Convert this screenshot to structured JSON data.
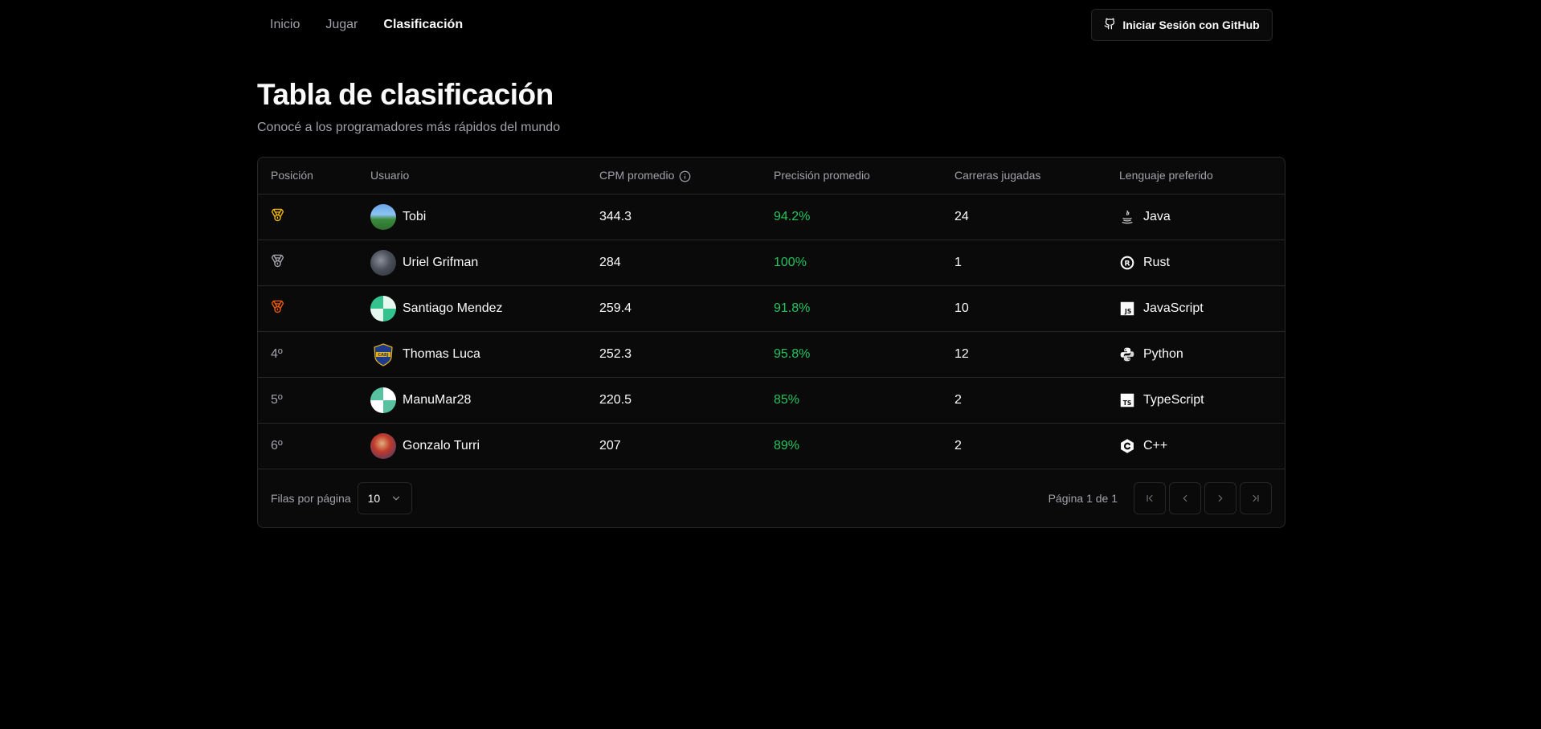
{
  "nav": {
    "links": [
      "Inicio",
      "Jugar",
      "Clasificación"
    ],
    "active": "Clasificación",
    "login_label": "Iniciar Sesión con GitHub"
  },
  "page": {
    "title": "Tabla de clasificación",
    "subtitle": "Conocé a los programadores más rápidos del mundo"
  },
  "table": {
    "headers": [
      "Posición",
      "Usuario",
      "CPM promedio",
      "Precisión promedio",
      "Carreras jugadas",
      "Lenguaje preferido"
    ],
    "rows": [
      {
        "position": "",
        "medal": "gold",
        "user": "Tobi",
        "cpm": "344.3",
        "precision": "94.2%",
        "races": "24",
        "language": "Java",
        "lang_icon": "java-icon"
      },
      {
        "position": "",
        "medal": "silver",
        "user": "Uriel Grifman",
        "cpm": "284",
        "precision": "100%",
        "races": "1",
        "language": "Rust",
        "lang_icon": "rust-icon"
      },
      {
        "position": "",
        "medal": "bronze",
        "user": "Santiago Mendez",
        "cpm": "259.4",
        "precision": "91.8%",
        "races": "10",
        "language": "JavaScript",
        "lang_icon": "javascript-icon"
      },
      {
        "position": "4º",
        "medal": "",
        "user": "Thomas Luca",
        "cpm": "252.3",
        "precision": "95.8%",
        "races": "12",
        "language": "Python",
        "lang_icon": "python-icon"
      },
      {
        "position": "5º",
        "medal": "",
        "user": "ManuMar28",
        "cpm": "220.5",
        "precision": "85%",
        "races": "2",
        "language": "TypeScript",
        "lang_icon": "typescript-icon"
      },
      {
        "position": "6º",
        "medal": "",
        "user": "Gonzalo Turri",
        "cpm": "207",
        "precision": "89%",
        "races": "2",
        "language": "C++",
        "lang_icon": "cpp-icon"
      }
    ]
  },
  "pagination": {
    "rows_label": "Filas por página",
    "rows_value": "10",
    "page_info": "Página 1 de 1"
  },
  "colors": {
    "background": "#000000",
    "card": "#0a0a0a",
    "border": "#27272a",
    "muted": "#a1a1aa",
    "success": "#22c55e",
    "gold": "#eab308",
    "silver": "#a1a1aa",
    "bronze": "#ea580c"
  }
}
